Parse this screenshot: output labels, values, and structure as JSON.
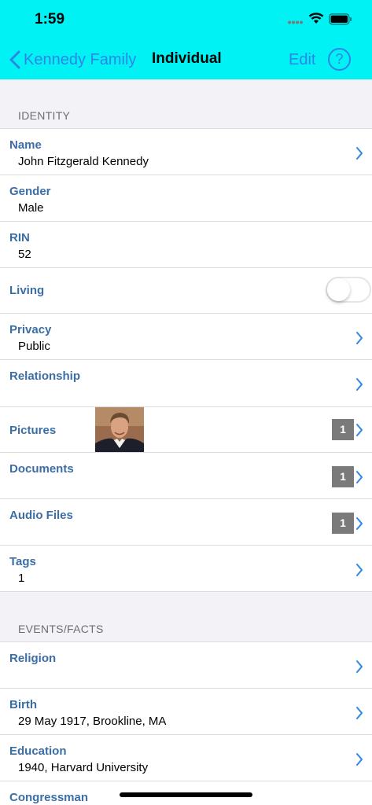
{
  "status": {
    "time": "1:59"
  },
  "navbar": {
    "back_label": "Kennedy Family",
    "title": "Individual",
    "edit_label": "Edit",
    "help_label": "?"
  },
  "colors": {
    "header_bg": "#00f2f5",
    "accent": "#2e86e6",
    "label": "#3b6ea5",
    "badge": "#7a7a7a"
  },
  "identity": {
    "header": "IDENTITY",
    "name_label": "Name",
    "name_value": "John Fitzgerald Kennedy",
    "gender_label": "Gender",
    "gender_value": "Male",
    "rin_label": "RIN",
    "rin_value": "52",
    "living_label": "Living",
    "living_on": false,
    "privacy_label": "Privacy",
    "privacy_value": "Public",
    "relationship_label": "Relationship",
    "pictures_label": "Pictures",
    "pictures_count": "1",
    "documents_label": "Documents",
    "documents_count": "1",
    "audio_label": "Audio Files",
    "audio_count": "1",
    "tags_label": "Tags",
    "tags_value": "1"
  },
  "events": {
    "header": "EVENTS/FACTS",
    "religion_label": "Religion",
    "birth_label": "Birth",
    "birth_value": "29 May 1917, Brookline, MA",
    "education_label": "Education",
    "education_value": "1940, Harvard University",
    "congressman_label": "Congressman"
  }
}
